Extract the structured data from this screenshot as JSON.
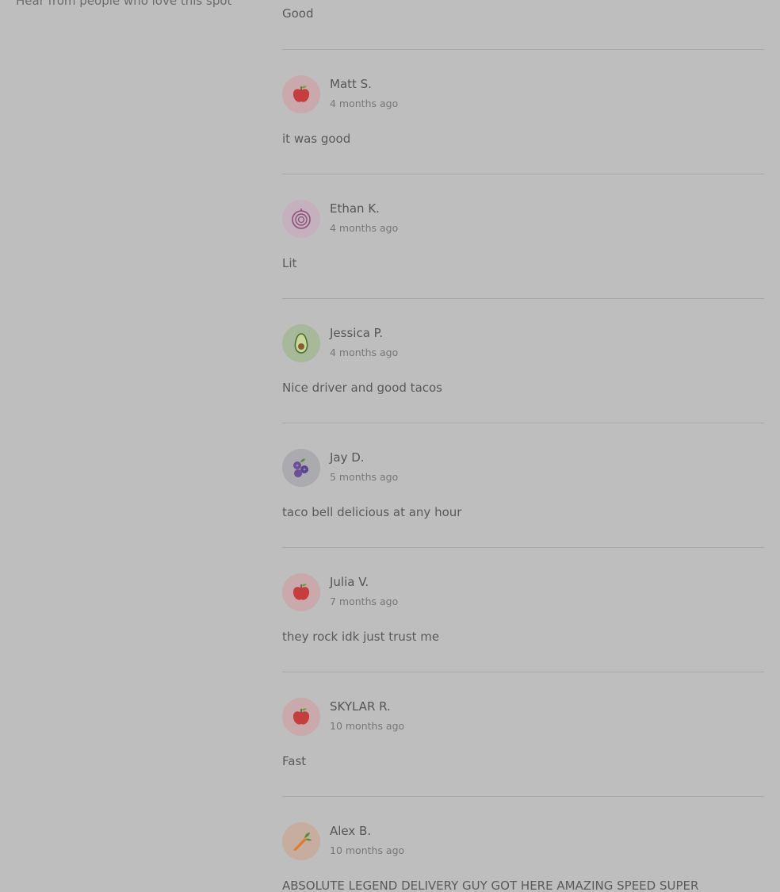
{
  "sidebar": {
    "subtitle": "Hear from people who love this spot"
  },
  "top_review_text": "Good",
  "reviews": [
    {
      "name": "Matt S.",
      "time": "4 months ago",
      "text": "it was good",
      "avatar": "apple-icon"
    },
    {
      "name": "Ethan K.",
      "time": "4 months ago",
      "text": "Lit",
      "avatar": "onion-icon"
    },
    {
      "name": "Jessica P.",
      "time": "4 months ago",
      "text": "Nice driver and good tacos",
      "avatar": "avocado-icon"
    },
    {
      "name": "Jay D.",
      "time": "5 months ago",
      "text": "taco bell delicious at any hour",
      "avatar": "blueberry-icon"
    },
    {
      "name": "Julia V.",
      "time": "7 months ago",
      "text": "they rock idk just trust me",
      "avatar": "apple-icon"
    },
    {
      "name": "SKYLAR R.",
      "time": "10 months ago",
      "text": "Fast",
      "avatar": "apple-icon"
    },
    {
      "name": "Alex B.",
      "time": "10 months ago",
      "text": "ABSOLUTE LEGEND DELIVERY GUY GOT HERE AMAZING SPEED SUPER",
      "avatar": "carrot-icon"
    }
  ],
  "colors": {
    "background": "#bebebe",
    "separator": "#a9a9a9",
    "apple_avatar_bg": "#c9a9ab",
    "onion_avatar_bg": "#c5b0bd",
    "avocado_avatar_bg": "#a7b99a",
    "blueberry_avatar_bg": "#aaaaaf",
    "carrot_avatar_bg": "#c6ad9f"
  }
}
